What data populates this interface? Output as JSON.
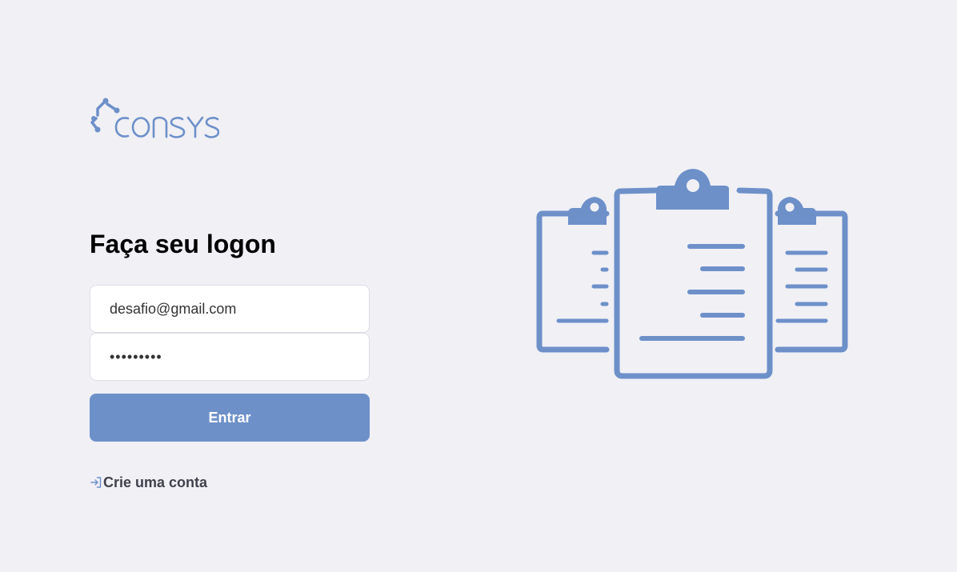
{
  "brand": {
    "name": "consys",
    "color": "#6d90c9"
  },
  "login": {
    "title": "Faça seu logon",
    "email_value": "desafio@gmail.com",
    "password_value": "•••••••••",
    "submit_label": "Entrar",
    "create_account_label": "Crie uma conta"
  },
  "colors": {
    "background": "#f0f0f5",
    "accent": "#6d90c9",
    "text_dark": "#41414d"
  },
  "icons": {
    "create_account": "log-in-icon",
    "illustration": "clipboards-illustration"
  }
}
